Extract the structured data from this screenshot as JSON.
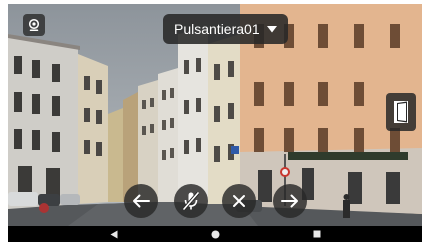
{
  "device_selector": {
    "label": "Pulsantiera01",
    "icon": "caret-down-icon"
  },
  "toolbar": {
    "snapshot_icon": "camera-lens-icon",
    "door_icon": "door-icon",
    "buttons": [
      {
        "name": "previous",
        "icon": "arrow-left-icon"
      },
      {
        "name": "microphone",
        "icon": "mic-off-icon"
      },
      {
        "name": "close",
        "icon": "close-icon"
      },
      {
        "name": "next",
        "icon": "arrow-right-icon"
      }
    ]
  },
  "navigation_bar": {
    "icons": [
      "back-triangle-icon",
      "home-circle-icon",
      "recents-square-icon"
    ]
  },
  "colors": {
    "overlay_bg": "#282828",
    "icon_color": "#ffffff",
    "sky": "#9aa2aa"
  }
}
